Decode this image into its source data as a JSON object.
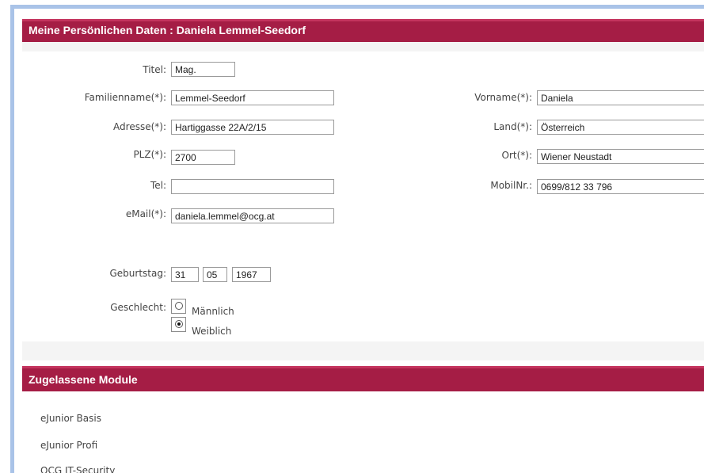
{
  "personal_section": {
    "title": "Meine Persönlichen Daten : Daniela Lemmel-Seedorf",
    "fields": {
      "titel": {
        "label": "Titel:",
        "value": "Mag."
      },
      "familienname": {
        "label": "Familienname(*):",
        "value": "Lemmel-Seedorf"
      },
      "adresse": {
        "label": "Adresse(*):",
        "value": "Hartiggasse 22A/2/15"
      },
      "plz": {
        "label": "PLZ(*):",
        "value": "2700"
      },
      "tel": {
        "label": "Tel:",
        "value": ""
      },
      "email": {
        "label": "eMail(*):",
        "value": "daniela.lemmel@ocg.at"
      },
      "vorname": {
        "label": "Vorname(*):",
        "value": "Daniela"
      },
      "land": {
        "label": "Land(*):",
        "value": "Österreich"
      },
      "ort": {
        "label": "Ort(*):",
        "value": "Wiener Neustadt"
      },
      "mobilnr": {
        "label": "MobilNr.:",
        "value": "0699/812 33 796"
      }
    },
    "birthday": {
      "label": "Geburtstag:",
      "day": "31",
      "month": "05",
      "year": "1967"
    },
    "gender": {
      "label": "Geschlecht:",
      "options": [
        {
          "label": "Männlich",
          "selected": false
        },
        {
          "label": "Weiblich",
          "selected": true
        }
      ]
    }
  },
  "modules_section": {
    "title": "Zugelassene Module",
    "items": [
      "eJunior Basis",
      "eJunior Profi",
      "OCG IT-Security"
    ]
  },
  "colors": {
    "header_bg": "#a51d45",
    "frame_border": "#a9c3e8",
    "band_bg": "#f4f4f4"
  }
}
